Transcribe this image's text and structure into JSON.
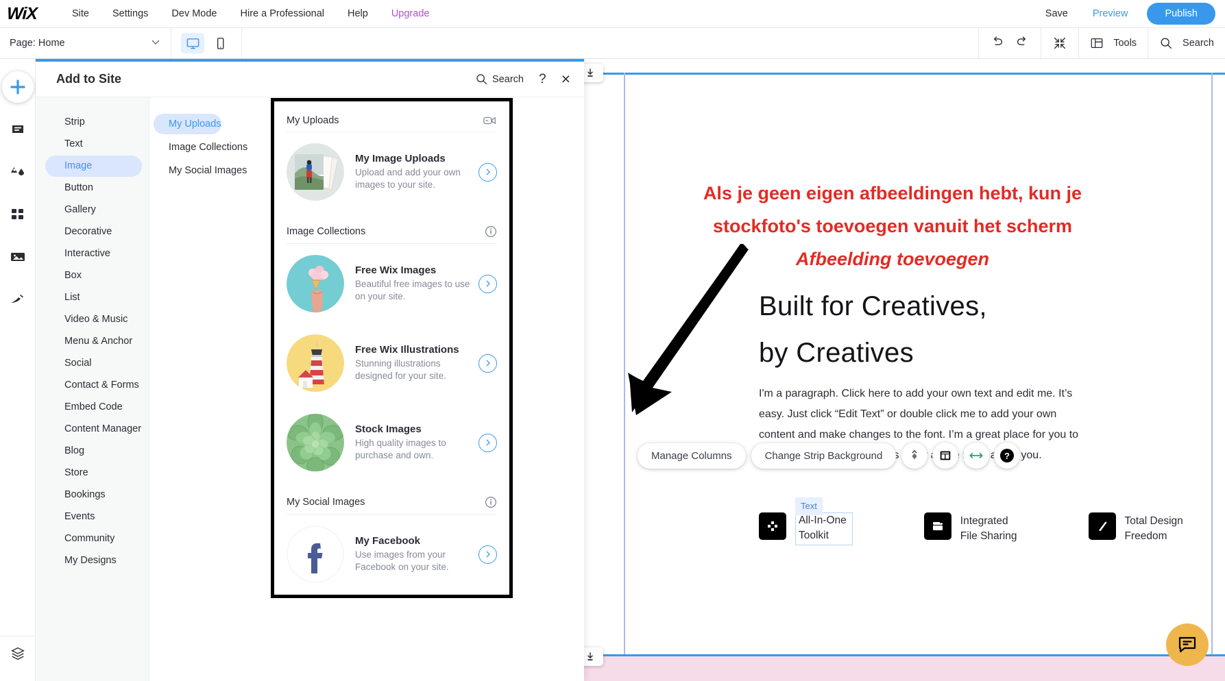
{
  "topbar": {
    "logo": "WiX",
    "menu": [
      "Site",
      "Settings",
      "Dev Mode",
      "Hire a Professional",
      "Help",
      "Upgrade"
    ],
    "save_label": "Save",
    "preview_label": "Preview",
    "publish_label": "Publish"
  },
  "secondbar": {
    "page_label": "Page: Home",
    "tools_label": "Tools",
    "search_label": "Search"
  },
  "rail": {
    "icons": [
      "add-icon",
      "pages-icon",
      "theme-icon",
      "apps-icon",
      "media-icon",
      "contribute-icon",
      "layers-icon"
    ]
  },
  "panel": {
    "title": "Add to Site",
    "search_label": "Search",
    "help_label": "?",
    "close_label": "×",
    "categories": [
      "Strip",
      "Text",
      "Image",
      "Button",
      "Gallery",
      "Decorative",
      "Interactive",
      "Box",
      "List",
      "Video & Music",
      "Menu & Anchor",
      "Social",
      "Contact & Forms",
      "Embed Code",
      "Content Manager",
      "Blog",
      "Store",
      "Bookings",
      "Events",
      "Community",
      "My Designs"
    ],
    "active_category": "Image",
    "subcategories": [
      "My Uploads",
      "Image Collections",
      "My Social Images"
    ],
    "active_subcategory": "My Uploads",
    "sections": [
      {
        "heading": "My Uploads",
        "heading_icon": "video-icon",
        "items": [
          {
            "title": "My Image Uploads",
            "desc": "Upload and add your own images to your site.",
            "thumb": "hiker-photo-thumb"
          }
        ]
      },
      {
        "heading": "Image Collections",
        "heading_icon": "info-icon",
        "items": [
          {
            "title": "Free Wix Images",
            "desc": "Beautiful free images to use on your site.",
            "thumb": "icecream-thumb"
          },
          {
            "title": "Free Wix Illustrations",
            "desc": "Stunning illustrations designed for your site.",
            "thumb": "lighthouse-thumb"
          },
          {
            "title": "Stock Images",
            "desc": "High quality images to purchase and own.",
            "thumb": "succulent-thumb"
          }
        ]
      },
      {
        "heading": "My Social Images",
        "heading_icon": "info-icon",
        "items": [
          {
            "title": "My Facebook",
            "desc": "Use images from your Facebook on your site.",
            "thumb": "facebook-thumb"
          }
        ]
      }
    ]
  },
  "annotation": {
    "line1": "Als je geen eigen afbeeldingen hebt, kun je",
    "line2": "stockfoto's toevoegen vanuit het scherm",
    "line3": "Afbeelding toevoegen",
    "color": "#e32b24"
  },
  "canvas": {
    "heading_line1": "Built for Creatives,",
    "heading_line2": "by Creatives",
    "paragraph": "I'm a paragraph. Click here to add your own text and edit me. It’s easy. Just click “Edit Text” or double click me to add your own content and make changes to the font. I’m a great place for you to tell a story and let your users know a little more about you.",
    "features": [
      {
        "label_line1": "All-In-One",
        "label_line2": "Toolkit",
        "icon": "toolkit-icon",
        "tag": "Text",
        "selected": true
      },
      {
        "label_line1": "Integrated",
        "label_line2": "File Sharing",
        "icon": "folder-icon",
        "tag": "",
        "selected": false
      },
      {
        "label_line1": "Total Design",
        "label_line2": "Freedom",
        "icon": "brush-icon",
        "tag": "",
        "selected": false
      }
    ],
    "float_tools": {
      "manage_columns": "Manage Columns",
      "change_strip_background": "Change Strip Background",
      "icons": [
        "animation-icon",
        "layout-icon",
        "stretch-icon",
        "help-icon"
      ]
    },
    "accent_blue": "#3899ec",
    "guide_color": "#aab8ee"
  },
  "chat": {
    "icon": "chat-icon",
    "color": "#efb64d"
  }
}
